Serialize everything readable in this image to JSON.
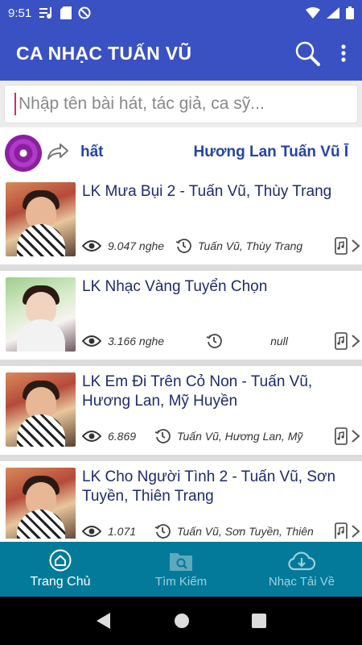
{
  "status_bar": {
    "time": "9:51"
  },
  "app_bar": {
    "title": "CA NHẠC TUẤN VŨ"
  },
  "search": {
    "placeholder": "Nhập tên bài hát, tác giả, ca sỹ..."
  },
  "now_playing": {
    "marquee_left": "hất",
    "marquee_right": "Hương Lan Tuấn Vũ Ī"
  },
  "songs": [
    {
      "title": "LK Mưa Bụi 2 - Tuấn Vũ, Thùy Trang",
      "views": "9.047 nghe",
      "artist": "Tuấn Vũ, Thùy Trang"
    },
    {
      "title": "LK Nhạc Vàng Tuyển Chọn",
      "views": "3.166 nghe",
      "artist": "null"
    },
    {
      "title": "LK Em Đi Trên Cỏ Non - Tuấn Vũ, Hương Lan, Mỹ Huyền",
      "views": "6.869",
      "artist": "Tuấn Vũ, Hương Lan, Mỹ"
    },
    {
      "title": "LK Cho Người Tình 2 - Tuấn Vũ, Sơn Tuyền, Thiên Trang",
      "views": "1.071",
      "artist": "Tuấn Vũ, Sơn Tuyền, Thiên"
    }
  ],
  "bottom_nav": [
    {
      "label": "Trang Chủ",
      "icon": "home-icon",
      "active": true
    },
    {
      "label": "Tìm Kiếm",
      "icon": "folder-search-icon",
      "active": false
    },
    {
      "label": "Nhạc Tải Về",
      "icon": "cloud-download-icon",
      "active": false
    }
  ],
  "colors": {
    "app_bar": "#3a51c3",
    "bottom_nav": "#047a9a",
    "title_text": "#1f2a6b",
    "marquee_text": "#2544a8",
    "disc": "#8a1f9f"
  }
}
